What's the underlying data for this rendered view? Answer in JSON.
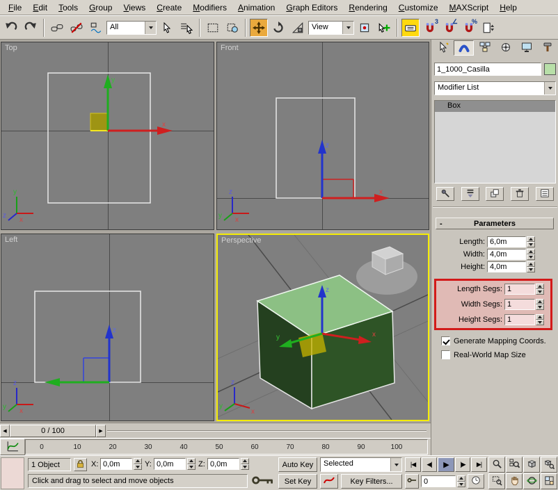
{
  "menu": {
    "items": [
      "File",
      "Edit",
      "Tools",
      "Group",
      "Views",
      "Create",
      "Modifiers",
      "Animation",
      "Graph Editors",
      "Rendering",
      "Customize",
      "MAXScript",
      "Help"
    ]
  },
  "toolbar": {
    "selection_filter": "All",
    "coord_system": "View",
    "snap_3": "3",
    "snap_angle": "∠",
    "snap_percent": "%"
  },
  "viewports": {
    "top_label": "Top",
    "front_label": "Front",
    "left_label": "Left",
    "perspective_label": "Perspective",
    "axis_x": "x",
    "axis_y": "y",
    "axis_z": "z"
  },
  "command_panel": {
    "object_name": "1_1000_Casilla",
    "object_color": "#b8dfa8",
    "modifier_list_label": "Modifier List",
    "stack": [
      "Box"
    ],
    "rollout": {
      "collapse_glyph": "-",
      "title": "Parameters"
    },
    "params": [
      {
        "label": "Length:",
        "value": "6,0m"
      },
      {
        "label": "Width:",
        "value": "4,0m"
      },
      {
        "label": "Height:",
        "value": "4,0m"
      }
    ],
    "segs": [
      {
        "label": "Length Segs:",
        "value": "1"
      },
      {
        "label": "Width Segs:",
        "value": "1"
      },
      {
        "label": "Height Segs:",
        "value": "1"
      }
    ],
    "checkbox_mapping": "Generate Mapping Coords.",
    "checkbox_realworld": "Real-World Map Size",
    "annotation_color": "#d21a1a"
  },
  "timeline": {
    "slider": "0 / 100",
    "ticks": [
      "0",
      "10",
      "20",
      "30",
      "40",
      "50",
      "60",
      "70",
      "80",
      "90",
      "100"
    ]
  },
  "status": {
    "object_count": "1 Object",
    "coords": [
      {
        "label": "X:",
        "value": "0,0m"
      },
      {
        "label": "Y:",
        "value": "0,0m"
      },
      {
        "label": "Z:",
        "value": "0,0m"
      }
    ],
    "prompt": "Click and drag to select and move objects",
    "auto_key": "Auto Key",
    "set_key": "Set Key",
    "selection_set": "Selected",
    "key_filters": "Key Filters...",
    "frame": "0"
  },
  "icons": {
    "nudge_left": "◀",
    "nudge_right": "▶",
    "go_start": "|◀",
    "frame_back": "◀|",
    "play": "▶",
    "frame_fwd": "|▶",
    "go_end": "▶|"
  }
}
